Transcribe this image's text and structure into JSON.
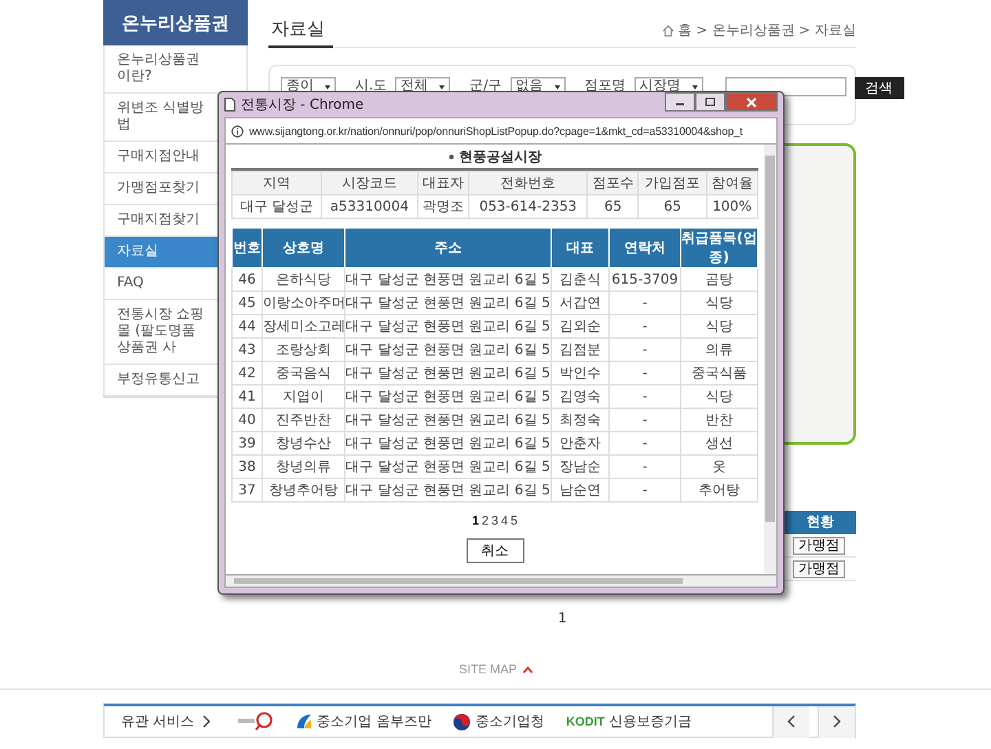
{
  "sidebar": {
    "title": "온누리상품권",
    "items": [
      {
        "label": "온누리상품권이란?",
        "selected": false
      },
      {
        "label": "위변조 식별방법",
        "selected": false
      },
      {
        "label": "구매지점안내",
        "selected": false
      },
      {
        "label": "가맹점포찾기",
        "selected": false
      },
      {
        "label": "구매지점찾기",
        "selected": false
      },
      {
        "label": "자료실",
        "selected": true
      },
      {
        "label": "FAQ",
        "selected": false
      },
      {
        "label": "전통시장 쇼핑몰 (팔도명품 상품권 사",
        "selected": false
      },
      {
        "label": "부정유통신고",
        "selected": false
      }
    ]
  },
  "main": {
    "title": "자료실",
    "breadcrumb": "홈 > 온누리상품권 > 자료실",
    "search": {
      "filters": [
        {
          "value": "종이"
        },
        {
          "label": "시.도",
          "value": "전체"
        },
        {
          "label": "군/구",
          "value": "없음"
        },
        {
          "label": "점포명",
          "value": "시장명"
        }
      ],
      "button": "검색"
    },
    "result_table": {
      "column_header": "현황",
      "row_buttons": [
        "가맹점",
        "가맹점"
      ]
    },
    "page_number": "1"
  },
  "site_map": "SITE MAP",
  "footer": {
    "related_label": "유관 서비스",
    "partners": [
      {
        "kind": "magnifier"
      },
      {
        "kind": "ombudsman",
        "name": "중소기업 옴부즈만"
      },
      {
        "kind": "emblem",
        "name": "중소기업청"
      },
      {
        "kind": "kodit",
        "mark": "KODIT",
        "name": "신용보증기금"
      }
    ]
  },
  "popup": {
    "title": "전통시장 - Chrome",
    "url": "www.sijangtong.or.kr/nation/onnuri/pop/onnuriShopListPopup.do?cpage=1&mkt_cd=a53310004&shop_t",
    "market": "현풍공설시장",
    "info": {
      "columns": [
        "지역",
        "시장코드",
        "대표자",
        "전화번호",
        "점포수",
        "가입점포",
        "참여율"
      ],
      "values": [
        "대구 달성군",
        "a53310004",
        "곽명조",
        "053-614-2353",
        "65",
        "65",
        "100%"
      ]
    },
    "shops": {
      "columns": [
        "번호",
        "상호명",
        "주소",
        "대표",
        "연락처",
        "취급품목(업종)"
      ],
      "rows": [
        [
          "46",
          "은하식당",
          "대구 달성군 현풍면 원교리 6길 5",
          "김춘식",
          "615-3709",
          "곰탕"
        ],
        [
          "45",
          "이랑소아주머",
          "대구 달성군 현풍면 원교리 6길 5",
          "서갑연",
          "-",
          "식당"
        ],
        [
          "44",
          "장세미소고레",
          "대구 달성군 현풍면 원교리 6길 5",
          "김외순",
          "-",
          "식당"
        ],
        [
          "43",
          "조랑상회",
          "대구 달성군 현풍면 원교리 6길 5",
          "김점분",
          "-",
          "의류"
        ],
        [
          "42",
          "중국음식",
          "대구 달성군 현풍면 원교리 6길 5",
          "박인수",
          "-",
          "중국식품"
        ],
        [
          "41",
          "지엽이",
          "대구 달성군 현풍면 원교리 6길 5",
          "김영숙",
          "-",
          "식당"
        ],
        [
          "40",
          "진주반찬",
          "대구 달성군 현풍면 원교리 6길 5",
          "최정숙",
          "-",
          "반찬"
        ],
        [
          "39",
          "창녕수산",
          "대구 달성군 현풍면 원교리 6길 5",
          "안춘자",
          "-",
          "생선"
        ],
        [
          "38",
          "창녕의류",
          "대구 달성군 현풍면 원교리 6길 5",
          "장남순",
          "-",
          "옷"
        ],
        [
          "37",
          "창녕추어탕",
          "대구 달성군 현풍면 원교리 6길 5",
          "남순연",
          "-",
          "추어탕"
        ]
      ]
    },
    "pages": [
      {
        "label": "1",
        "selected": true
      },
      {
        "label": "2",
        "selected": false
      },
      {
        "label": "3",
        "selected": false
      },
      {
        "label": "4",
        "selected": false
      },
      {
        "label": "5",
        "selected": false
      }
    ],
    "cancel": "취소"
  }
}
